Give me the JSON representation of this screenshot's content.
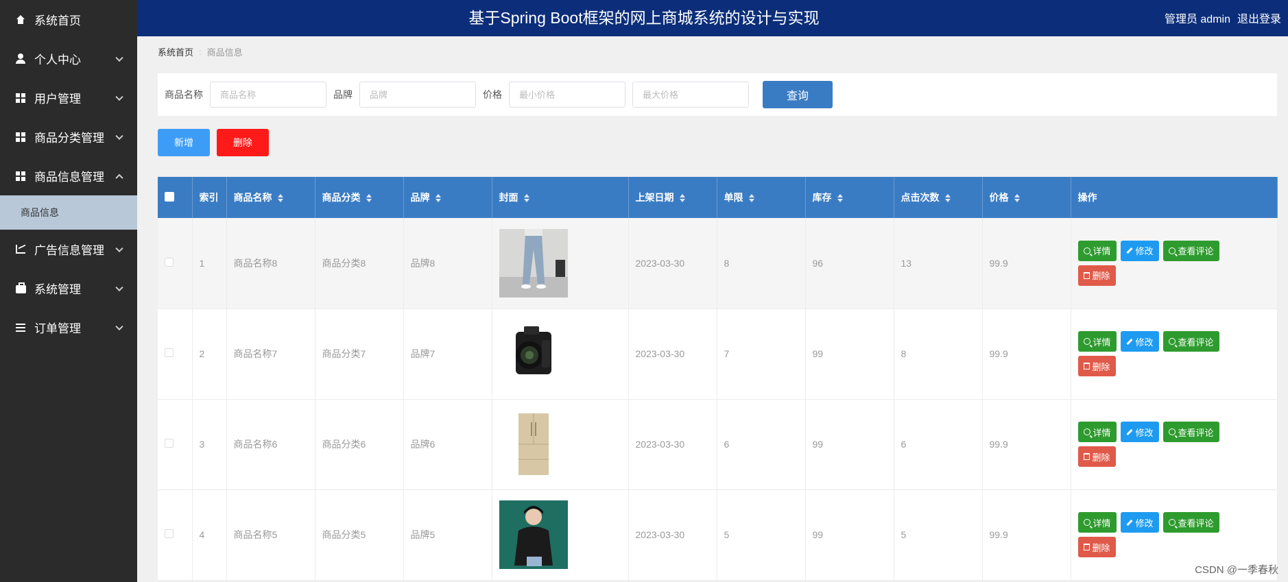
{
  "sidebar": {
    "items": [
      {
        "label": "系统首页",
        "icon": "home-icon"
      },
      {
        "label": "个人中心",
        "icon": "user-icon"
      },
      {
        "label": "用户管理",
        "icon": "grid-icon"
      },
      {
        "label": "商品分类管理",
        "icon": "grid-icon"
      },
      {
        "label": "商品信息管理",
        "icon": "grid-icon"
      },
      {
        "label": "广告信息管理",
        "icon": "chart-icon"
      },
      {
        "label": "系统管理",
        "icon": "briefcase-icon"
      },
      {
        "label": "订单管理",
        "icon": "sliders-icon"
      }
    ],
    "sub_item": "商品信息"
  },
  "header": {
    "title": "基于Spring Boot框架的网上商城系统的设计与实现",
    "user": "管理员 admin",
    "logout": "退出登录"
  },
  "breadcrumb": {
    "home": "系统首页",
    "current": "商品信息"
  },
  "search": {
    "name_label": "商品名称",
    "name_placeholder": "商品名称",
    "brand_label": "品牌",
    "brand_placeholder": "品牌",
    "price_label": "价格",
    "min_placeholder": "最小价格",
    "max_placeholder": "最大价格",
    "query": "查询"
  },
  "actions": {
    "add": "新增",
    "delete": "删除"
  },
  "table": {
    "headers": {
      "index": "索引",
      "name": "商品名称",
      "category": "商品分类",
      "brand": "品牌",
      "cover": "封面",
      "date": "上架日期",
      "limit": "单限",
      "stock": "库存",
      "clicks": "点击次数",
      "price": "价格",
      "ops": "操作"
    },
    "op_labels": {
      "detail": "详情",
      "edit": "修改",
      "comments": "查看评论",
      "delete": "删除"
    },
    "rows": [
      {
        "index": "1",
        "name": "商品名称8",
        "category": "商品分类8",
        "brand": "品牌8",
        "date": "2023-03-30",
        "limit": "8",
        "stock": "96",
        "clicks": "13",
        "price": "99.9"
      },
      {
        "index": "2",
        "name": "商品名称7",
        "category": "商品分类7",
        "brand": "品牌7",
        "date": "2023-03-30",
        "limit": "7",
        "stock": "99",
        "clicks": "8",
        "price": "99.9"
      },
      {
        "index": "3",
        "name": "商品名称6",
        "category": "商品分类6",
        "brand": "品牌6",
        "date": "2023-03-30",
        "limit": "6",
        "stock": "99",
        "clicks": "6",
        "price": "99.9"
      },
      {
        "index": "4",
        "name": "商品名称5",
        "category": "商品分类5",
        "brand": "品牌5",
        "date": "2023-03-30",
        "limit": "5",
        "stock": "99",
        "clicks": "5",
        "price": "99.9"
      }
    ]
  },
  "watermark": "CSDN @一季春秋"
}
